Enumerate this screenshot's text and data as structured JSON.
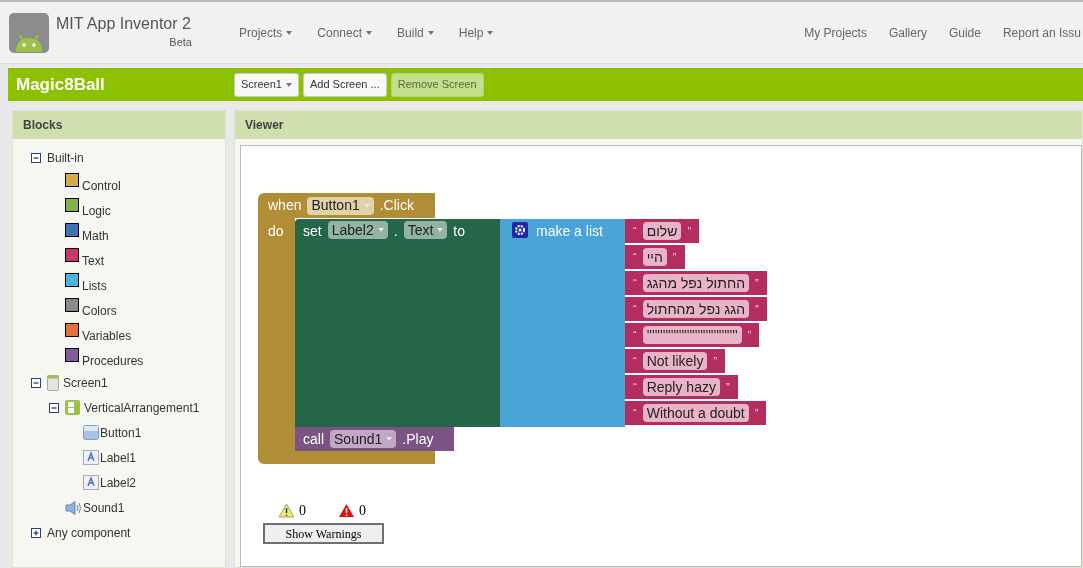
{
  "header": {
    "title": "MIT App Inventor 2",
    "subtitle": "Beta",
    "menus": [
      "Projects",
      "Connect",
      "Build",
      "Help"
    ],
    "links": [
      "My Projects",
      "Gallery",
      "Guide",
      "Report an Issu"
    ]
  },
  "project_bar": {
    "name": "Magic8Ball",
    "screen_dropdown": "Screen1",
    "buttons": [
      {
        "label": "Add Screen ...",
        "disabled": false
      },
      {
        "label": "Remove Screen",
        "disabled": true
      }
    ]
  },
  "blocks_panel": {
    "title": "Blocks",
    "tree": [
      {
        "label": "Built-in",
        "expanded": true,
        "children": [
          {
            "label": "Control",
            "color": "#d4aa4f"
          },
          {
            "label": "Logic",
            "color": "#7fb24a"
          },
          {
            "label": "Math",
            "color": "#3f71b5"
          },
          {
            "label": "Text",
            "color": "#c4386b"
          },
          {
            "label": "Lists",
            "color": "#4db3dd"
          },
          {
            "label": "Colors",
            "color": "#8a8a8a"
          },
          {
            "label": "Variables",
            "color": "#e1723a"
          },
          {
            "label": "Procedures",
            "color": "#835d99"
          }
        ]
      },
      {
        "label": "Screen1",
        "kind": "screen",
        "expanded": true,
        "children": [
          {
            "label": "VerticalArrangement1",
            "kind": "arrangement",
            "expanded": true,
            "children": [
              {
                "label": "Button1",
                "kind": "button"
              },
              {
                "label": "Label1",
                "kind": "label"
              },
              {
                "label": "Label2",
                "kind": "label"
              }
            ]
          },
          {
            "label": "Sound1",
            "kind": "sound"
          }
        ]
      },
      {
        "label": "Any component",
        "expanded": false
      }
    ]
  },
  "viewer": {
    "title": "Viewer",
    "event_block": {
      "when": "when",
      "component": "Button1",
      "event": ".Click",
      "do": "do"
    },
    "set_block": {
      "set": "set",
      "component": "Label2",
      "dot": ".",
      "property": "Text",
      "to": "to"
    },
    "list_block": {
      "label": "make a list"
    },
    "text_blocks": [
      {
        "open": "“",
        "value": "שלום",
        "close": "”"
      },
      {
        "open": "“",
        "value": "היי",
        "close": "”"
      },
      {
        "open": "“",
        "value": "החתול נפל מהגג",
        "close": "”"
      },
      {
        "open": "“",
        "value": "הגג נפל מהחתול",
        "close": "”"
      },
      {
        "open": "“",
        "value": "''''''''''''''''''''''''''''''''''",
        "close": "”"
      },
      {
        "open": "“",
        "value": "Not likely",
        "close": "”"
      },
      {
        "open": "“",
        "value": "Reply hazy",
        "close": "”"
      },
      {
        "open": "“",
        "value": "Without a doubt",
        "close": "”"
      }
    ],
    "call_block": {
      "call": "call",
      "component": "Sound1",
      "method": ".Play"
    },
    "warnings": {
      "warning_count": "0",
      "error_count": "0",
      "button": "Show Warnings"
    }
  }
}
